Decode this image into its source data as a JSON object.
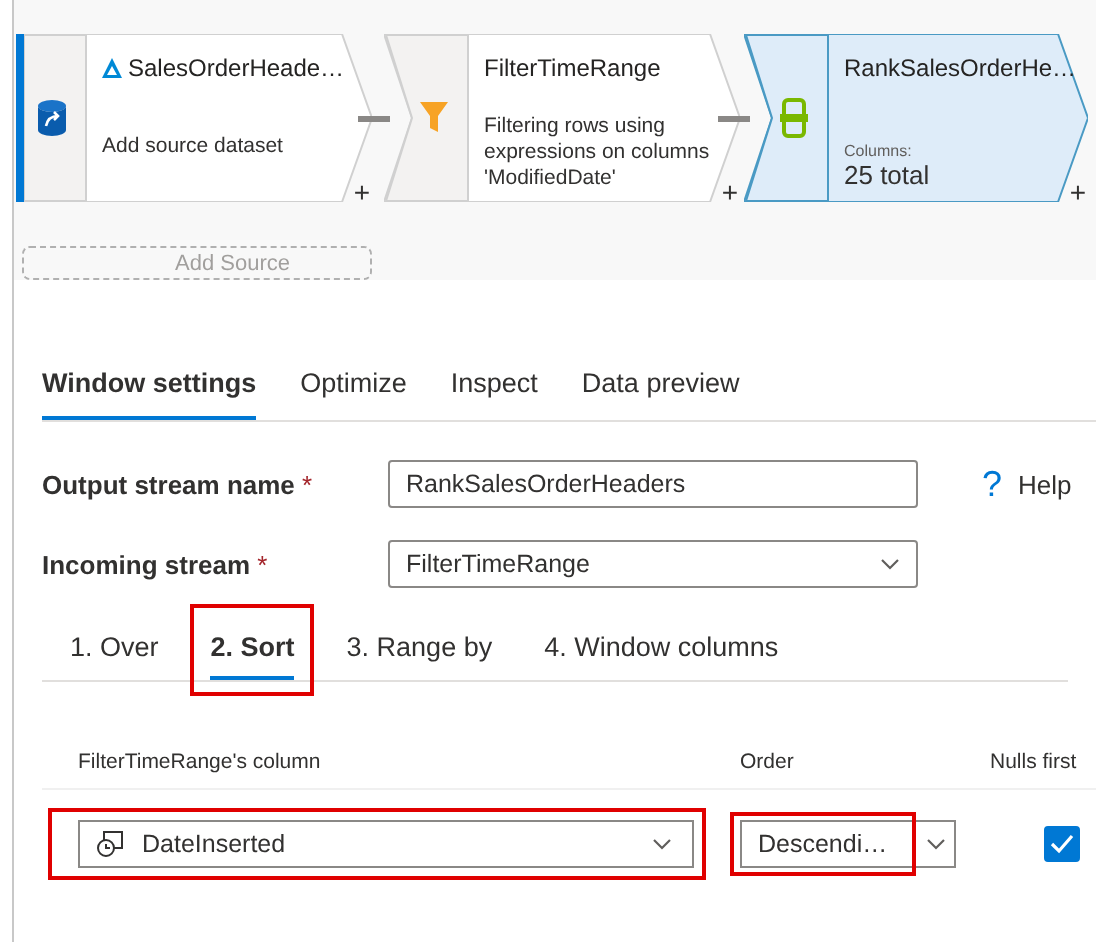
{
  "canvas": {
    "nodes": [
      {
        "kind": "source",
        "title": "SalesOrderHeade…",
        "description": "Add source dataset",
        "add": "+",
        "selected": false
      },
      {
        "kind": "filter",
        "title": "FilterTimeRange",
        "description": "Filtering rows using expressions on columns 'ModifiedDate'",
        "add": "+",
        "selected": false
      },
      {
        "kind": "window",
        "title": "RankSalesOrderHe…",
        "caption": "Columns:",
        "value": "25 total",
        "add": "+",
        "selected": true
      }
    ],
    "add_source": {
      "label": "Add Source"
    }
  },
  "tabs": [
    {
      "label": "Window settings",
      "selected": true
    },
    {
      "label": "Optimize",
      "selected": false
    },
    {
      "label": "Inspect",
      "selected": false
    },
    {
      "label": "Data preview",
      "selected": false
    }
  ],
  "form": {
    "fields": [
      {
        "kind": "text",
        "label": "Output stream name",
        "required": "*",
        "value": "RankSalesOrderHeaders"
      },
      {
        "kind": "select",
        "label": "Incoming stream",
        "required": "*",
        "value": "FilterTimeRange"
      }
    ],
    "help": {
      "icon": "?",
      "label": "Help"
    }
  },
  "subtabs": [
    {
      "label": "1. Over",
      "selected": false,
      "highlighted": false
    },
    {
      "label": "2. Sort",
      "selected": true,
      "highlighted": true
    },
    {
      "label": "3. Range by",
      "selected": false,
      "highlighted": false
    },
    {
      "label": "4. Window columns",
      "selected": false,
      "highlighted": false
    }
  ],
  "sort": {
    "columns": [
      "FilterTimeRange's column",
      "Order",
      "Nulls first"
    ],
    "rows": [
      {
        "column": "DateInserted",
        "column_highlighted": true,
        "order": "Descendi…",
        "order_highlighted": true,
        "nulls_first": true
      }
    ]
  }
}
